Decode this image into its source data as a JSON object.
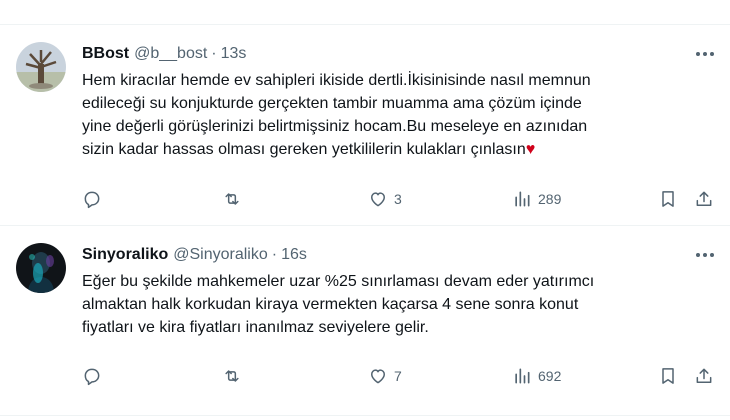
{
  "tweets": [
    {
      "display_name": "BBost",
      "handle": "@b__bost",
      "separator": "·",
      "time": "13s",
      "text": "Hem kiracılar hemde ev sahipleri ikiside dertli.İkisinisinde nasıl  memnun\nedileceği su konjukturde gerçekten tambir muamma ama çözüm içinde\nyine değerli görüşlerinizi belirtmişsiniz hocam.Bu meseleye en azınıdan\nsizin kadar hassas olması gereken yetkililerin kulakları çınlasın",
      "emoji": "♥",
      "reply_count": "",
      "retweet_count": "",
      "like_count": "3",
      "view_count": "289",
      "avatar_icon": "tree-sculpture-avatar"
    },
    {
      "display_name": "Sinyoraliko",
      "handle": "@Sinyoraliko",
      "separator": "·",
      "time": "16s",
      "text": "Eğer bu şekilde mahkemeler uzar %25 sınırlaması devam eder yatırımcı\nalmaktan halk korkudan kiraya vermekten kaçarsa 4 sene sonra konut\nfiyatları ve kira fiyatları inanılmaz seviyelere gelir.",
      "emoji": "",
      "reply_count": "",
      "retweet_count": "",
      "like_count": "7",
      "view_count": "692",
      "avatar_icon": "dark-neon-avatar"
    }
  ],
  "colors": {
    "text_primary": "#0f1419",
    "text_secondary": "#536471",
    "divider": "#eff3f4",
    "heart_emoji": "#d0021b"
  }
}
